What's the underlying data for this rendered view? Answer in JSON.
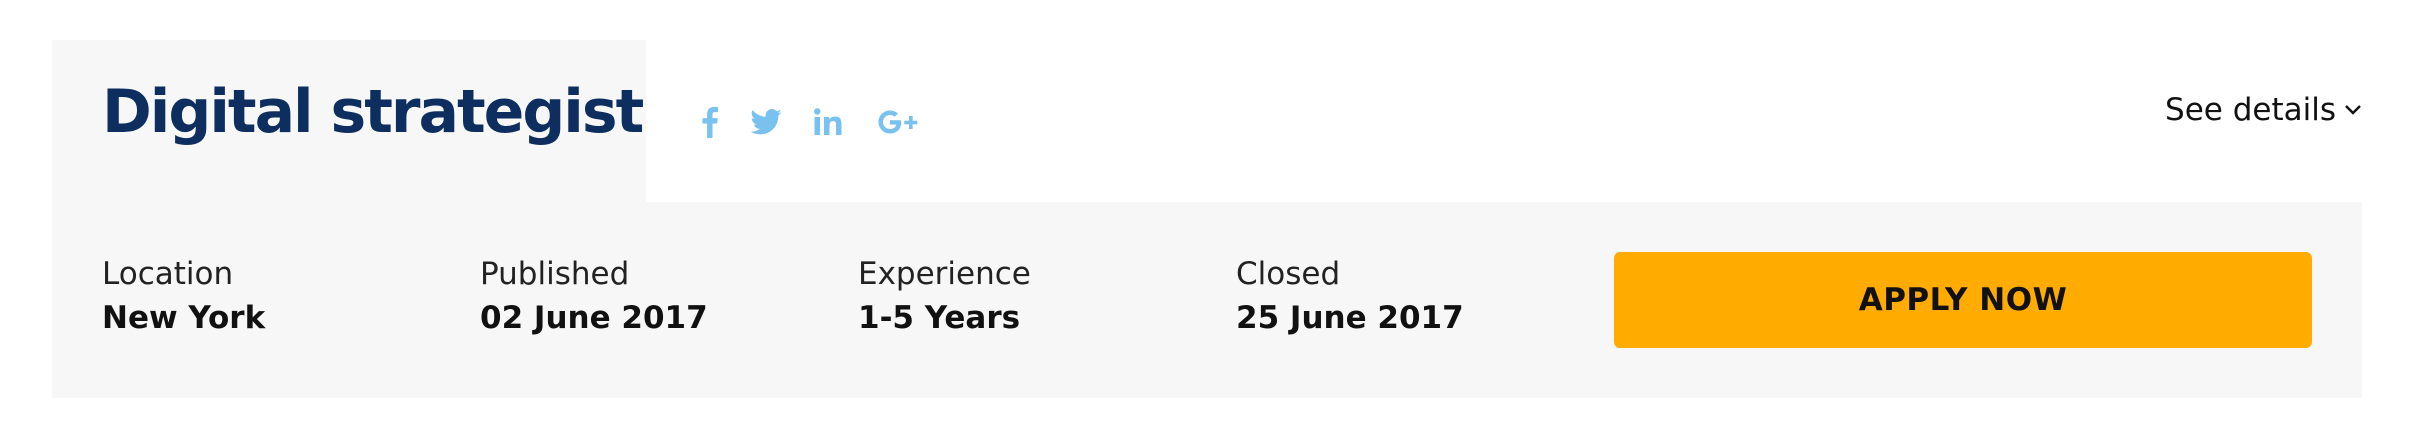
{
  "job": {
    "title": "Digital strategist",
    "details_label": "See details"
  },
  "social": {
    "color": "#79c2ef",
    "items": [
      {
        "icon": "facebook-icon"
      },
      {
        "icon": "twitter-icon"
      },
      {
        "icon": "linkedin-icon"
      },
      {
        "icon": "google-plus-icon"
      }
    ]
  },
  "info": [
    {
      "label": "Location",
      "value": "New York"
    },
    {
      "label": "Published",
      "value": "02 June 2017"
    },
    {
      "label": "Experience",
      "value": "1-5 Years"
    },
    {
      "label": "Closed",
      "value": "25 June 2017"
    }
  ],
  "apply": {
    "label": "APPLY NOW",
    "color": "#ffab00"
  },
  "colors": {
    "title": "#0d2e5e",
    "panel": "#f7f7f7"
  }
}
